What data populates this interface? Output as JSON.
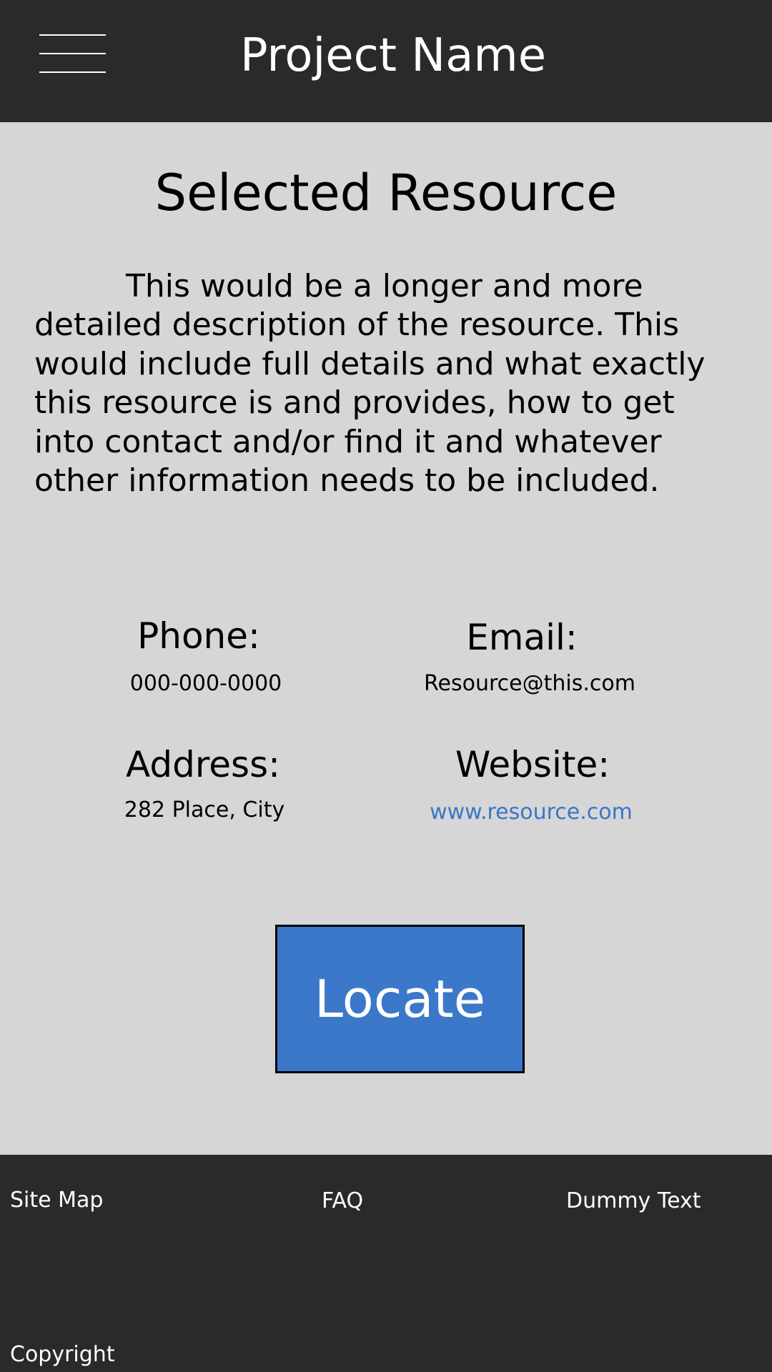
{
  "header": {
    "title": "Project Name",
    "menu_icon": "hamburger-menu-icon"
  },
  "main": {
    "title": "Selected Resource",
    "description": "This would be a longer and more detailed description of the resource.  This would include full details and what exactly this resource is and provides, how to get into contact and/or find it and whatever other information needs to be included.",
    "contact": {
      "phone_label": "Phone:",
      "phone_value": "000-000-0000",
      "email_label": "Email:",
      "email_value": "Resource@this.com",
      "address_label": "Address:",
      "address_value": "282 Place, City",
      "website_label": "Website:",
      "website_value": "www.resource.com"
    },
    "locate_label": "Locate"
  },
  "footer": {
    "links": [
      "Site Map",
      "FAQ",
      "Dummy Text"
    ],
    "copyright": "Copyright"
  },
  "colors": {
    "header_bg": "#2a2a2a",
    "page_bg": "#d6d6d7",
    "accent": "#3c78c9",
    "link": "#3a76c8"
  }
}
